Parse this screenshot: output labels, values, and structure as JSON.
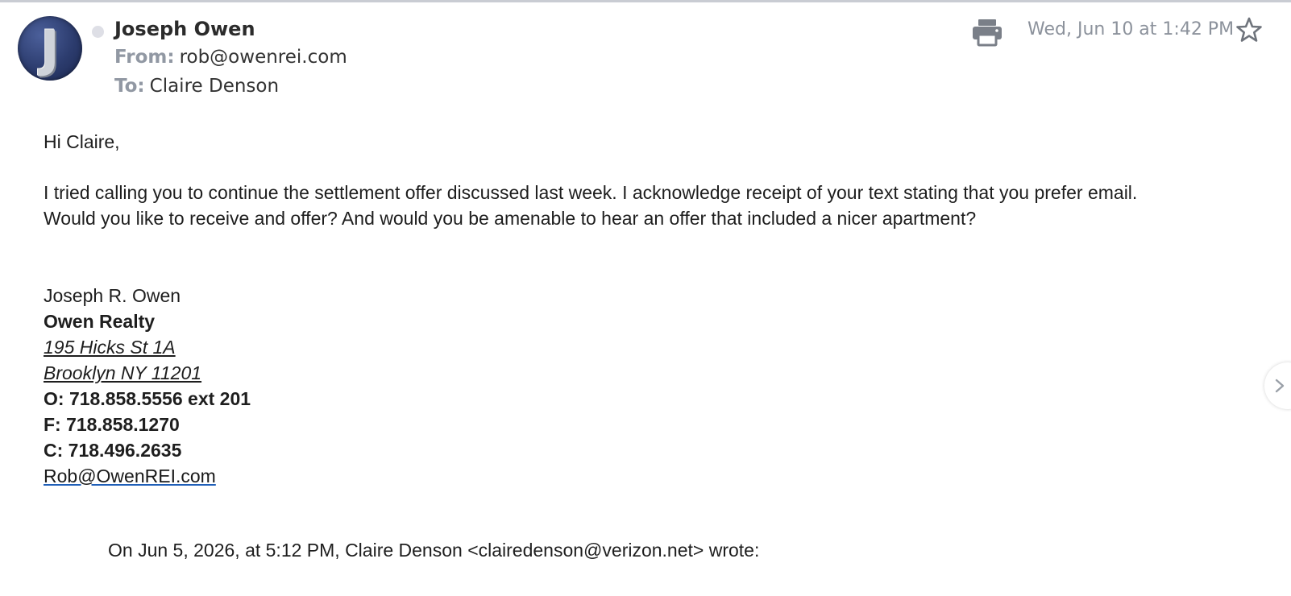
{
  "header": {
    "avatar_initial": "J",
    "sender_name": "Joseph Owen",
    "from_label": "From:",
    "from_value": "rob@owenrei.com",
    "to_label": "To:",
    "to_value": "Claire Denson",
    "date": "Wed, Jun 10 at 1:42 PM",
    "icons": [
      "printer-icon",
      "star-icon",
      "chevron-right-icon"
    ]
  },
  "body": {
    "greeting": "Hi Claire,",
    "paragraph_line1": "I tried calling you to continue the settlement offer discussed last week. I acknowledge receipt of your text stating that you prefer email.",
    "paragraph_line2": "Would you like to receive and offer? And would you be amenable to hear an offer that included a nicer apartment?"
  },
  "signature": {
    "name": "Joseph R. Owen",
    "company": "Owen Realty",
    "address_line1": "195 Hicks St 1A",
    "address_line2": "Brooklyn NY 11201",
    "office": "O: 718.858.5556 ext 201",
    "fax": "F:  718.858.1270",
    "cell": "C:  718.496.2635",
    "email": "Rob@OwenREI.com"
  },
  "quote": {
    "attribution": "On Jun 5, 2026, at 5:12 PM, Claire Denson <clairedenson@verizon.net> wrote:"
  },
  "colors": {
    "label_gray": "#9198a3",
    "date_gray": "#8c929c",
    "avatar_blue": "#2c3c6e",
    "link_blue": "#1f5fb8"
  }
}
